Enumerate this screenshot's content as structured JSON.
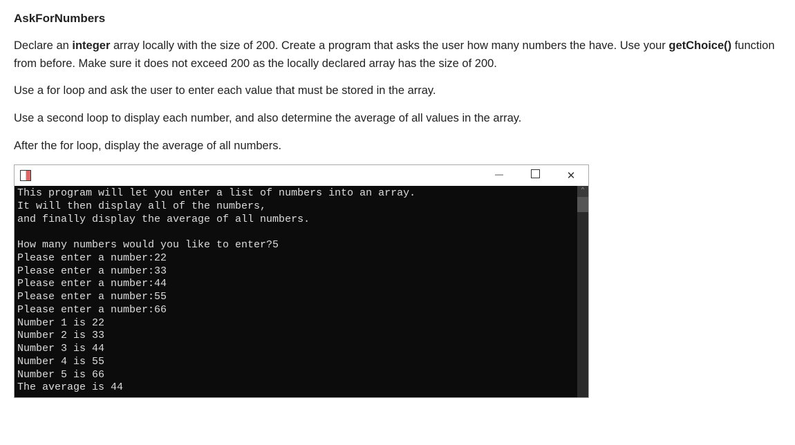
{
  "title": "AskForNumbers",
  "paragraphs": {
    "p1_a": "Declare an ",
    "p1_b": "integer",
    "p1_c": " array locally with the size of 200. Create a program that asks the user how many numbers the have. Use your ",
    "p1_d": "getChoice()",
    "p1_e": " function from before. Make sure it does not exceed 200 as the locally declared array has the size of 200.",
    "p2": "Use a for loop and ask the user to enter each value that must be stored in the array.",
    "p3": "Use a second loop to display each number, and also determine the average of all values in the array.",
    "p4": "After the for loop, display the average of all numbers."
  },
  "console": {
    "lines": [
      "This program will let you enter a list of numbers into an array.",
      "It will then display all of the numbers,",
      "and finally display the average of all numbers.",
      "",
      "How many numbers would you like to enter?5",
      "Please enter a number:22",
      "Please enter a number:33",
      "Please enter a number:44",
      "Please enter a number:55",
      "Please enter a number:66",
      "Number 1 is 22",
      "Number 2 is 33",
      "Number 3 is 44",
      "Number 4 is 55",
      "Number 5 is 66",
      "The average is 44"
    ]
  },
  "win": {
    "close_glyph": "✕",
    "scroll_up_glyph": "⌃"
  }
}
